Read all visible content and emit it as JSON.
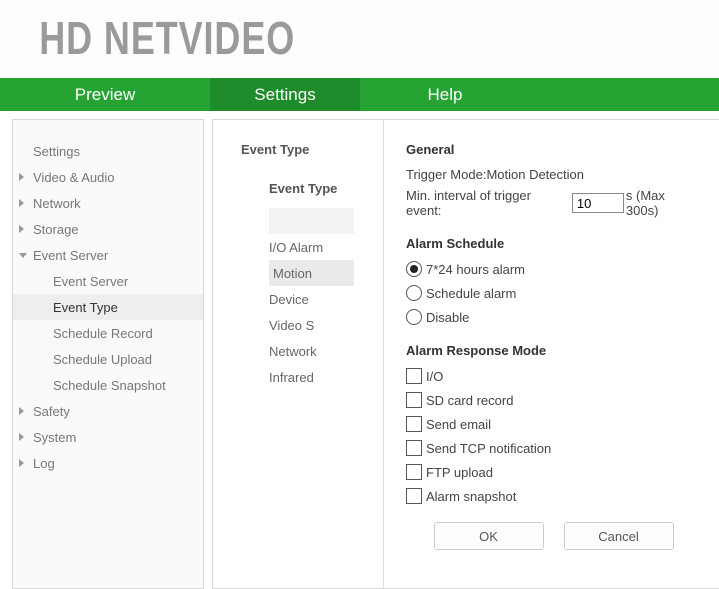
{
  "brand": "HD NETVIDEO",
  "nav": {
    "preview": "Preview",
    "settings": "Settings",
    "help": "Help"
  },
  "sidebar": {
    "settings": "Settings",
    "video_audio": "Video & Audio",
    "network": "Network",
    "storage": "Storage",
    "event_server": "Event Server",
    "children": {
      "event_server": "Event Server",
      "event_type": "Event Type",
      "schedule_record": "Schedule Record",
      "schedule_upload": "Schedule Upload",
      "schedule_snapshot": "Schedule Snapshot"
    },
    "safety": "Safety",
    "system": "System",
    "log": "Log"
  },
  "main": {
    "title": "Event Type",
    "list_header": "Event Type",
    "types": {
      "io_alarm": "I/O Alarm",
      "motion": "Motion",
      "device": "Device",
      "video_s": "Video S",
      "network": "Network",
      "infrared": "Infrared"
    }
  },
  "panel": {
    "general": {
      "heading": "General",
      "trigger_label": "Trigger Mode:",
      "trigger_value": "Motion Detection",
      "interval_label": "Min. interval of trigger event:",
      "interval_value": "10",
      "interval_unit": "s (Max 300s)"
    },
    "schedule": {
      "heading": "Alarm Schedule",
      "opt_247": "7*24 hours alarm",
      "opt_schedule": "Schedule alarm",
      "opt_disable": "Disable",
      "selected": "247"
    },
    "response": {
      "heading": "Alarm Response Mode",
      "io": "I/O",
      "sd": "SD card record",
      "email": "Send email",
      "tcp": "Send TCP notification",
      "ftp": "FTP upload",
      "snapshot": "Alarm snapshot"
    },
    "buttons": {
      "ok": "OK",
      "cancel": "Cancel"
    }
  }
}
